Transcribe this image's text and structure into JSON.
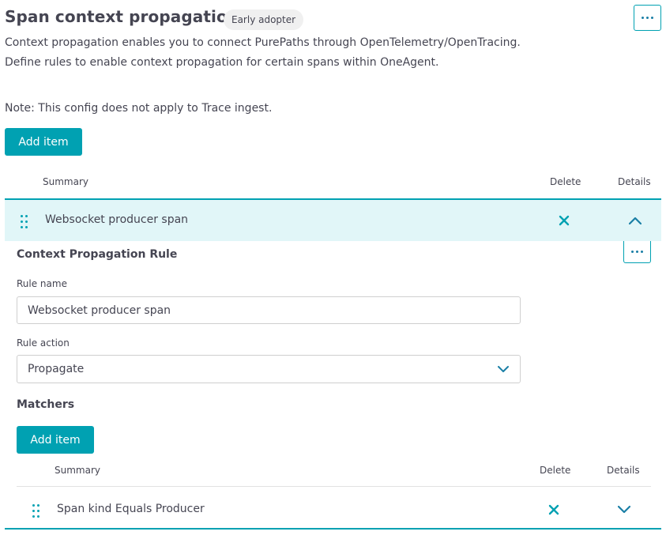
{
  "header": {
    "title": "Span context propagation",
    "badge": "Early adopter",
    "description": "Context propagation enables you to connect PurePaths through OpenTelemetry/OpenTracing. Define rules to enable context propagation for certain spans within OneAgent.",
    "note": "Note: This config does not apply to Trace ingest.",
    "add_label": "Add item"
  },
  "table": {
    "columns": {
      "summary": "Summary",
      "delete": "Delete",
      "details": "Details"
    },
    "rows": [
      {
        "summary": "Websocket producer span",
        "expanded": true
      }
    ]
  },
  "detail": {
    "section_title": "Context Propagation Rule",
    "rule_name_label": "Rule name",
    "rule_name_value": "Websocket producer span",
    "rule_action_label": "Rule action",
    "rule_action_value": "Propagate",
    "matchers_title": "Matchers",
    "matchers_add_label": "Add item",
    "matchers_table": {
      "columns": {
        "summary": "Summary",
        "delete": "Delete",
        "details": "Details"
      },
      "rows": [
        {
          "summary": "Span kind Equals Producer",
          "expanded": false
        }
      ]
    }
  },
  "colors": {
    "accent": "#00a1b2",
    "expanded_row_bg": "#e1f6f8",
    "text": "#454552"
  },
  "icons": [
    "more-icon",
    "drag-handle-icon",
    "close-icon",
    "chevron-up-icon",
    "chevron-down-icon"
  ]
}
